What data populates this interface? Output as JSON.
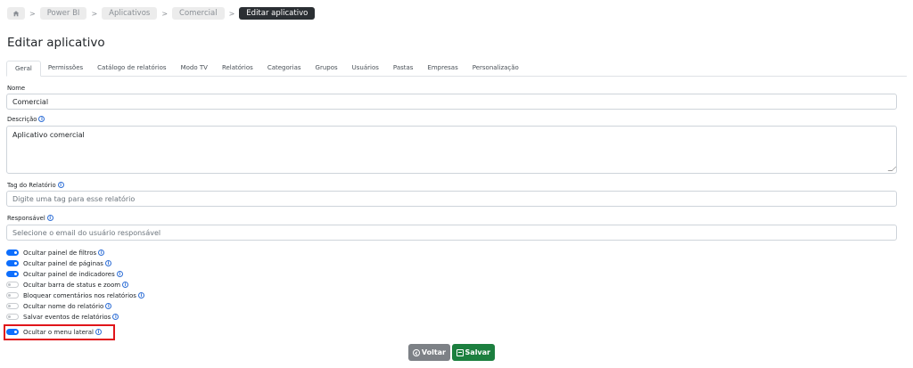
{
  "breadcrumb": {
    "home_icon": "home-icon",
    "items": [
      "Power BI",
      "Aplicativos",
      "Comercial"
    ],
    "active": "Editar aplicativo",
    "separator": ">"
  },
  "page_title": "Editar aplicativo",
  "tabs": [
    "Geral",
    "Permissões",
    "Catálogo de relatórios",
    "Modo TV",
    "Relatórios",
    "Categorias",
    "Grupos",
    "Usuários",
    "Pastas",
    "Empresas",
    "Personalização"
  ],
  "active_tab": "Geral",
  "form": {
    "nome_label": "Nome",
    "nome_value": "Comercial",
    "descricao_label": "Descrição",
    "descricao_value": "Aplicativo comercial",
    "tag_label": "Tag do Relatório",
    "tag_placeholder": "Digite uma tag para esse relatório",
    "responsavel_label": "Responsável",
    "responsavel_placeholder": "Selecione o email do usuário responsável"
  },
  "toggles": [
    {
      "label": "Ocultar painel de filtros",
      "on": true
    },
    {
      "label": "Ocultar painel de páginas",
      "on": true
    },
    {
      "label": "Ocultar painel de indicadores",
      "on": true
    },
    {
      "label": "Ocultar barra de status e zoom",
      "on": false
    },
    {
      "label": "Bloquear comentários nos relatórios",
      "on": false
    },
    {
      "label": "Ocultar nome do relatório",
      "on": false
    },
    {
      "label": "Salvar eventos de relatórios",
      "on": false
    },
    {
      "label": "Ocultar o menu lateral",
      "on": true
    }
  ],
  "buttons": {
    "back_label": "Voltar",
    "save_label": "Salvar"
  },
  "colors": {
    "accent": "#0d6efd",
    "save": "#1c7f3f",
    "back": "#7d8186",
    "highlight": "#e0151a"
  }
}
